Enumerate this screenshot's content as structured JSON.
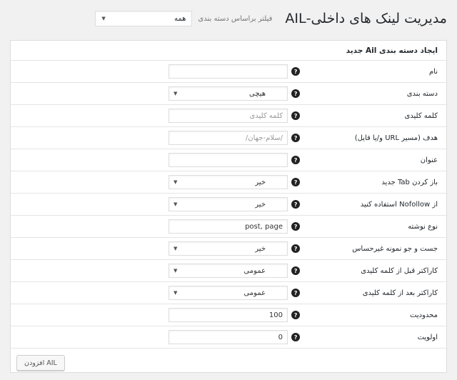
{
  "header": {
    "title": "مدیریت لینک های داخلی-AIL",
    "filter_label": "فیلتر براساس دسته بندی",
    "filter_value": "همه"
  },
  "panel": {
    "title": "ایجاد دسته بندی Ail جدید",
    "rows": [
      {
        "label": "نام",
        "type": "text",
        "value": "",
        "placeholder": ""
      },
      {
        "label": "دسته بندی",
        "type": "select",
        "value": "هیچی"
      },
      {
        "label": "کلمه کلیدی",
        "type": "text",
        "value": "",
        "placeholder": "کلمه کلیدی"
      },
      {
        "label": "هدف (مسیر URL و/یا فایل)",
        "type": "text",
        "value": "",
        "placeholder": "/سلام-جهان/"
      },
      {
        "label": "عنوان",
        "type": "text",
        "value": "",
        "placeholder": ""
      },
      {
        "label": "باز کردن Tab جدید",
        "type": "select",
        "value": "خیر"
      },
      {
        "label": "از Nofollow استفاده کنید",
        "type": "select",
        "value": "خیر"
      },
      {
        "label": "نوع نوشته",
        "type": "text",
        "value": "post, page",
        "placeholder": ""
      },
      {
        "label": "جست و جو نمونه غیرحساس",
        "type": "select",
        "value": "خیر"
      },
      {
        "label": "کاراکتر قبل از کلمه کلیدی",
        "type": "select",
        "value": "عمومی"
      },
      {
        "label": "کاراکتر بعد از کلمه کلیدی",
        "type": "select",
        "value": "عمومی"
      },
      {
        "label": "محدودیت",
        "type": "number",
        "value": "100"
      },
      {
        "label": "اولویت",
        "type": "number",
        "value": "0"
      }
    ],
    "help_glyph": "?",
    "submit_label": "افزودن AIL"
  },
  "icons": {
    "help": "help-icon",
    "caret": "chevron-down-icon"
  }
}
